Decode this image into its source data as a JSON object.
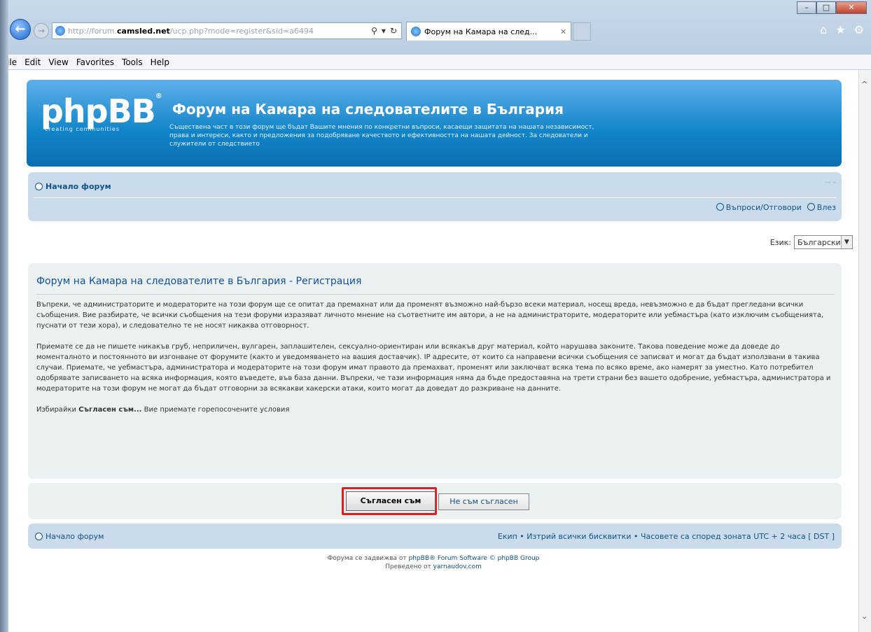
{
  "browser": {
    "url_prefix": "http://forum.",
    "url_host": "camsled.net",
    "url_rest": "/ucp.php?mode=register&sid=a6494",
    "tab_title": "Форум на Камара на след...",
    "menu": [
      "File",
      "Edit",
      "View",
      "Favorites",
      "Tools",
      "Help"
    ]
  },
  "header": {
    "logo": "phpBB",
    "logo_tagline": "creating communities",
    "title": "Форум на Камара на следователите в България",
    "description": "Съществена част в този форум ще бъдат Вашите мнения по конкретни въпроси, касаещи защитата на нашата независимост, права и интереси, както и предложения за подобряване качеството и ефективността на нашата дейност. За следователи и служители от следствието"
  },
  "navbar": {
    "home": "Начало форум",
    "faq": "Въпроси/Отговори",
    "login": "Влез"
  },
  "language": {
    "label": "Език:",
    "selected": "Български"
  },
  "panel": {
    "title": "Форум на Камара на следователите в България - Регистрация",
    "para1": "Въпреки, че администраторите и модераторите на този форум ще се опитат да премахнат или да променят възможно най-бързо всеки материал, носещ вреда, невъзможно е да бъдат прегледани всички съобщения. Вие разбирате, че всички съобщения на тези форуми изразяват личното мнение на съответните им автори, а не на администраторите, модераторите или уебмастъра (като изключим съобщенията, пуснати от тези хора), и следователно те не носят никаква отговорност.",
    "para2": "Приемате се да не пишете никакъв груб, неприличен, вулгарен, заплашителен, сексуално-ориентиран или всякакъв друг материал, който нарушава законите. Такова поведение може да доведе до моменталното и постоянното ви изгонване от форумите (както и уведомяването на вашия доставчик). IP адресите, от които са направени всички съобщения се записват и могат да бъдат използвани в такива случаи. Приемате, че уебмастъра, администратора и модераторите на този форум имат правото да премахват, променят или заключват всяка тема по всяко време, ако намерят за уместно. Като потребител одобрявате записването на всяка информация, която въведете, във база данни. Въпреки, че тази информация няма да бъде предоставяна на трети страни без вашето одобрение, уебмастъра, администратора и модераторите на този форум не могат да бъдат отговорни за всякакви хакерски атаки, които могат да доведат до разкриване на данните.",
    "para3_prefix": "Избирайки",
    "para3_bold": "Съгласен съм...",
    "para3_suffix": "Вие приемате горепосочените условия"
  },
  "buttons": {
    "agree": "Съгласен съм",
    "disagree": "Не съм съгласен"
  },
  "footer": {
    "home": "Начало форум",
    "right": "Екип • Изтрий всички бисквитки • Часовете са според зоната UTC + 2 часа [ DST ]",
    "powered_prefix": "Форума се задвижва от",
    "powered_link": "phpBB® Forum Software © phpBB Group",
    "translated_prefix": "Преведено от",
    "translated_link": "yarnaudov.com"
  }
}
